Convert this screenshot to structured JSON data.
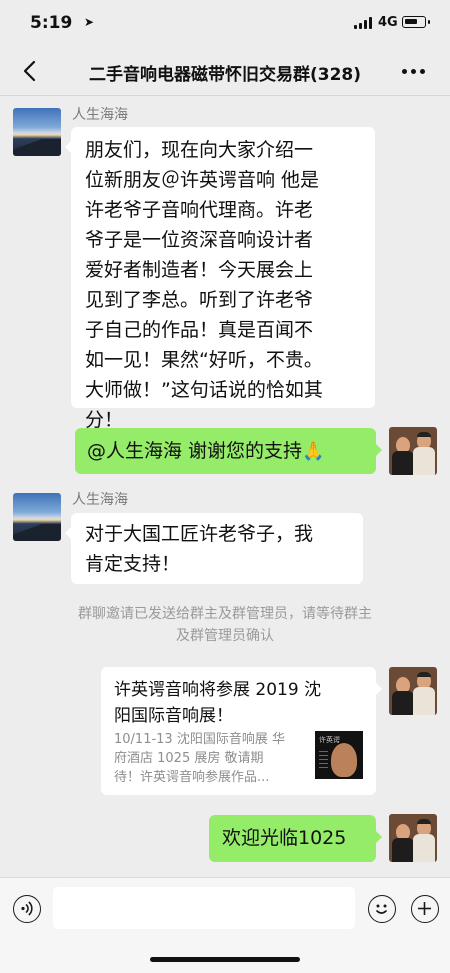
{
  "status_bar": {
    "time": "5:19",
    "network": "4G"
  },
  "nav": {
    "title": "二手音响电器磁带怀旧交易群(328)"
  },
  "messages": {
    "m1": {
      "sender": "人生海海",
      "lines": [
        "朋友们，现在向大家介绍一",
        "位新朋友＠许英谔音响 他是",
        "许老爷子音响代理商。许老",
        "爷子是一位资深音响设计者",
        "爱好者制造者！今天展会上",
        "见到了李总。听到了许老爷",
        "子自己的作品！真是百闻不",
        "如一见！果然“好听，不贵。",
        "大师做！”这句话说的恰如其",
        "分！"
      ]
    },
    "m2": {
      "text": "@人生海海 谢谢您的支持",
      "emoji": "🙏"
    },
    "m3": {
      "sender": "人生海海",
      "lines": [
        "对于大国工匠许老爷子，我",
        "肯定支持！"
      ]
    },
    "system": {
      "lines": [
        "群聊邀请已发送给群主及群管理员，请等待群主",
        "及群管理员确认"
      ]
    },
    "m4": {
      "title_lines": [
        "许英谔音响将参展 2019 沈",
        "阳国际音响展！"
      ],
      "desc_lines": [
        "10/11-13 沈阳国际音响展 华",
        "府酒店 1025 展房 敬请期",
        "待！许英谔音响参展作品..."
      ],
      "thumb_label": "许英谔"
    },
    "m5": {
      "text": "欢迎光临1025"
    }
  },
  "input": {
    "placeholder": ""
  },
  "colors": {
    "background": "#ededed",
    "bubble_self": "#95ec69",
    "bubble_other": "#ffffff"
  }
}
